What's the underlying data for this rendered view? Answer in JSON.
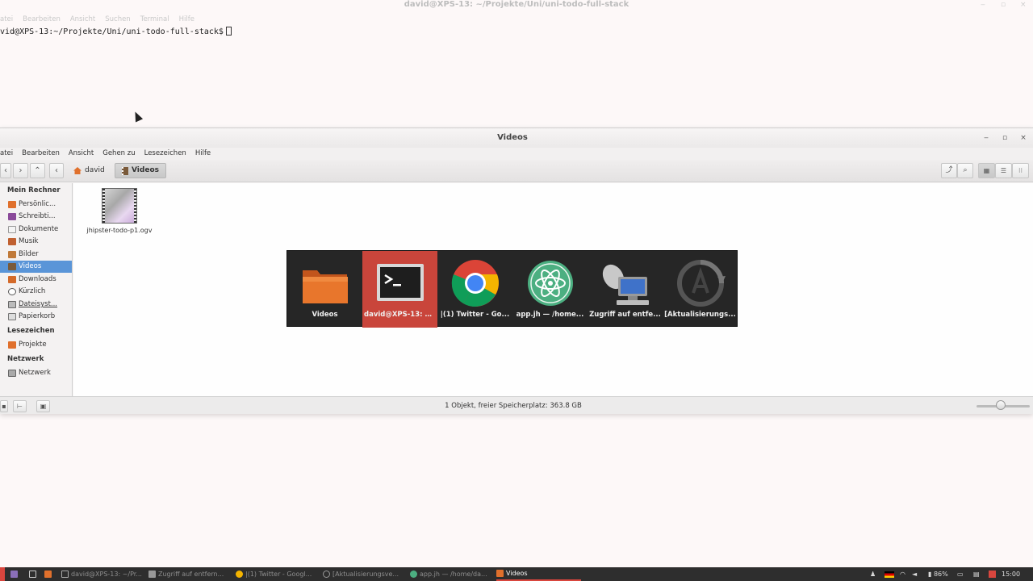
{
  "terminal": {
    "title": "david@XPS-13: ~/Projekte/Uni/uni-todo-full-stack",
    "menu": [
      "atei",
      "Bearbeiten",
      "Ansicht",
      "Suchen",
      "Terminal",
      "Hilfe"
    ],
    "prompt": "vid@XPS-13:~/Projekte/Uni/uni-todo-full-stack$"
  },
  "file_manager": {
    "title": "Videos",
    "window_controls": {
      "minimize": "‒",
      "maximize": "▫",
      "close": "×"
    },
    "menu": [
      "atei",
      "Bearbeiten",
      "Ansicht",
      "Gehen zu",
      "Lesezeichen",
      "Hilfe"
    ],
    "toolbar": {
      "back": "‹",
      "forward": "›",
      "up": "⌃",
      "crumb_back": "‹"
    },
    "breadcrumb": [
      "david",
      "Videos"
    ],
    "sidebar": {
      "heading_computer": "Mein Rechner",
      "computer_items": [
        "Persönlic...",
        "Schreibti...",
        "Dokumente",
        "Musik",
        "Bilder",
        "Videos",
        "Downloads",
        "Kürzlich",
        "Dateisyst...",
        "Papierkorb"
      ],
      "heading_bookmarks": "Lesezeichen",
      "bookmark_items": [
        "Projekte"
      ],
      "heading_network": "Netzwerk",
      "network_items": [
        "Netzwerk"
      ],
      "selected": "Videos"
    },
    "files": [
      {
        "name": "jhipster-todo-p1.ogv"
      }
    ],
    "status": "1 Objekt, freier Speicherplatz: 363.8 GB",
    "zoom_level": 0.45
  },
  "switcher": {
    "items": [
      {
        "label": "Videos",
        "icon": "folder-icon"
      },
      {
        "label": "david@XPS-13: ~...",
        "icon": "terminal-icon"
      },
      {
        "label": "|(1) Twitter - Go...",
        "icon": "chrome-icon"
      },
      {
        "label": "app.jh — /home...",
        "icon": "atom-icon"
      },
      {
        "label": "Zugriff auf entfe...",
        "icon": "remote-desktop-icon"
      },
      {
        "label": "[Aktualisierungs...",
        "icon": "update-manager-icon"
      }
    ],
    "selected_index": 1
  },
  "taskbar": {
    "windows": [
      {
        "label": "david@XPS-13: ~/Pr...",
        "icon": "terminal-icon"
      },
      {
        "label": "Zugriff auf entfern...",
        "icon": "remote-desktop-icon"
      },
      {
        "label": "|(1) Twitter - Googl...",
        "icon": "chrome-icon"
      },
      {
        "label": "[Aktualisierungsve...",
        "icon": "update-manager-icon"
      },
      {
        "label": "app.jh — /home/da...",
        "icon": "atom-icon"
      },
      {
        "label": "Videos",
        "icon": "folder-icon"
      }
    ],
    "active_window": "Videos",
    "battery": "86%",
    "clock": "15:00"
  },
  "colors": {
    "selection": "#5a95d8",
    "switcher_selected": "#c9453b",
    "taskbar_bg": "#2e2e2e"
  }
}
